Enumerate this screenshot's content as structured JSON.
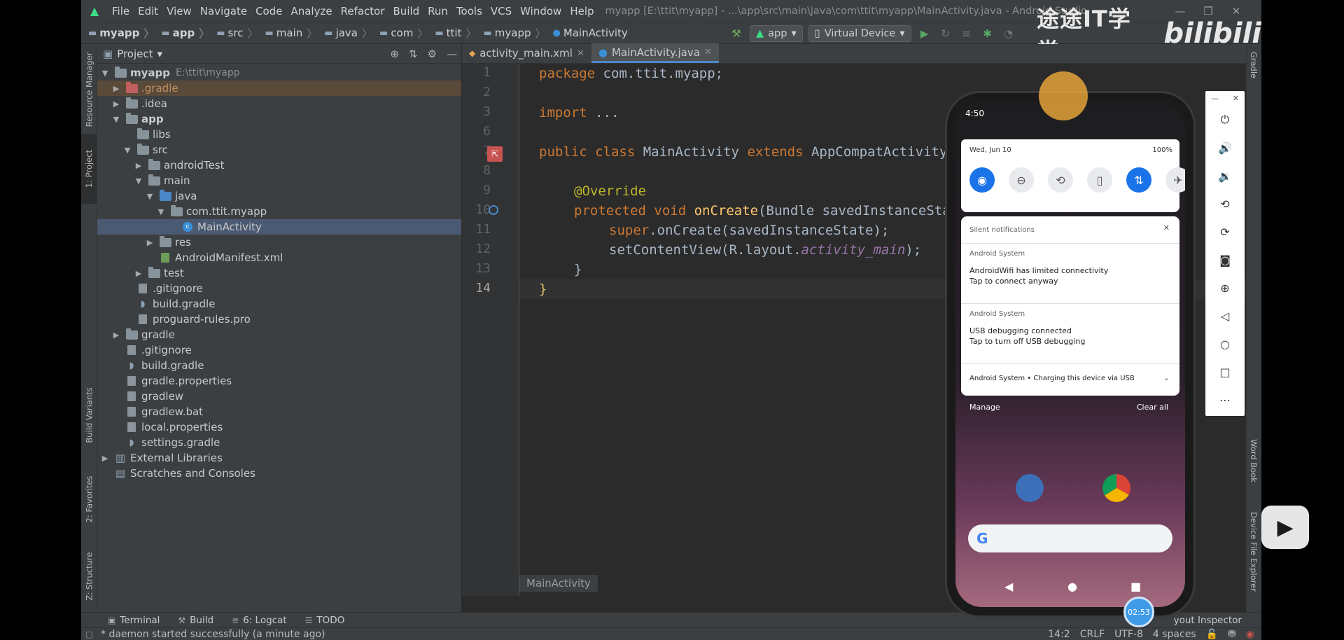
{
  "window": {
    "title": "myapp [E:\\ttit\\myapp] - ...\\app\\src\\main\\java\\com\\ttit\\myapp\\MainActivity.java - Android Studio",
    "menus": [
      "File",
      "Edit",
      "View",
      "Navigate",
      "Code",
      "Analyze",
      "Refactor",
      "Build",
      "Run",
      "Tools",
      "VCS",
      "Window",
      "Help"
    ]
  },
  "breadcrumbs": [
    "myapp",
    "app",
    "src",
    "main",
    "java",
    "com",
    "ttit",
    "myapp",
    "MainActivity"
  ],
  "toolbar": {
    "run_config": "app",
    "device": "Virtual Device"
  },
  "watermark": {
    "text": "途途IT学堂",
    "brand": "bilibili"
  },
  "left_strip": [
    "Resource Manager",
    "1: Project",
    "Build Variants",
    "2: Favorites",
    "Z: Structure"
  ],
  "right_strip": [
    "Gradle",
    "Word Book",
    "Device File Explorer"
  ],
  "project_panel": {
    "title": "Project",
    "tree": [
      {
        "label": "myapp",
        "sub": "E:\\ttit\\myapp"
      },
      {
        "label": ".gradle"
      },
      {
        "label": ".idea"
      },
      {
        "label": "app"
      },
      {
        "label": "libs"
      },
      {
        "label": "src"
      },
      {
        "label": "androidTest"
      },
      {
        "label": "main"
      },
      {
        "label": "java"
      },
      {
        "label": "com.ttit.myapp"
      },
      {
        "label": "MainActivity"
      },
      {
        "label": "res"
      },
      {
        "label": "AndroidManifest.xml"
      },
      {
        "label": "test"
      },
      {
        "label": ".gitignore"
      },
      {
        "label": "build.gradle"
      },
      {
        "label": "proguard-rules.pro"
      },
      {
        "label": "gradle"
      },
      {
        "label": ".gitignore"
      },
      {
        "label": "build.gradle"
      },
      {
        "label": "gradle.properties"
      },
      {
        "label": "gradlew"
      },
      {
        "label": "gradlew.bat"
      },
      {
        "label": "local.properties"
      },
      {
        "label": "settings.gradle"
      },
      {
        "label": "External Libraries"
      },
      {
        "label": "Scratches and Consoles"
      }
    ]
  },
  "editor": {
    "tabs": [
      "activity_main.xml",
      "MainActivity.java"
    ],
    "line_numbers": [
      "1",
      "2",
      "3",
      "6",
      "7",
      "8",
      "9",
      "10",
      "11",
      "12",
      "13",
      "14"
    ],
    "code_tokens": {
      "package_kw": "package",
      "package_name": " com.ttit.myapp;",
      "import_kw": "import",
      "import_rest": " ...",
      "class_kw": "public class ",
      "class_name": "MainActivity",
      "extends_kw": " extends ",
      "parent": "AppCompatActivity",
      "brace_open": " {",
      "override": "@Override",
      "method_mods": "protected void ",
      "method_name": "onCreate",
      "method_params": "(Bundle savedInstanceState) {",
      "super_kw": "super",
      "super_call": ".onCreate(savedInstanceState);",
      "set_content": "setContentView(R.layout.",
      "layout_field": "activity_main",
      "set_content_end": ");",
      "inner_close": "}",
      "outer_close": "}"
    },
    "breadcrumb": "MainActivity"
  },
  "emulator": {
    "time": "4:50",
    "date": "Wed, Jun 10",
    "battery": "100%",
    "silent_header": "Silent notifications",
    "notifications": [
      {
        "app": "Android System",
        "title": "AndroidWifi has limited connectivity",
        "text": "Tap to connect anyway"
      },
      {
        "app": "Android System",
        "title": "USB debugging connected",
        "text": "Tap to turn off USB debugging"
      }
    ],
    "charging": "Android System • Charging this device via USB",
    "manage": "Manage",
    "clear_all": "Clear all",
    "timer": "02:53"
  },
  "bottom_tools": [
    "Terminal",
    "Build",
    "6: Logcat",
    "TODO"
  ],
  "layout_inspector": "yout Inspector",
  "status": {
    "message": "* daemon started successfully (a minute ago)",
    "position": "14:2",
    "line_sep": "CRLF",
    "encoding": "UTF-8",
    "indent": "4 spaces"
  }
}
